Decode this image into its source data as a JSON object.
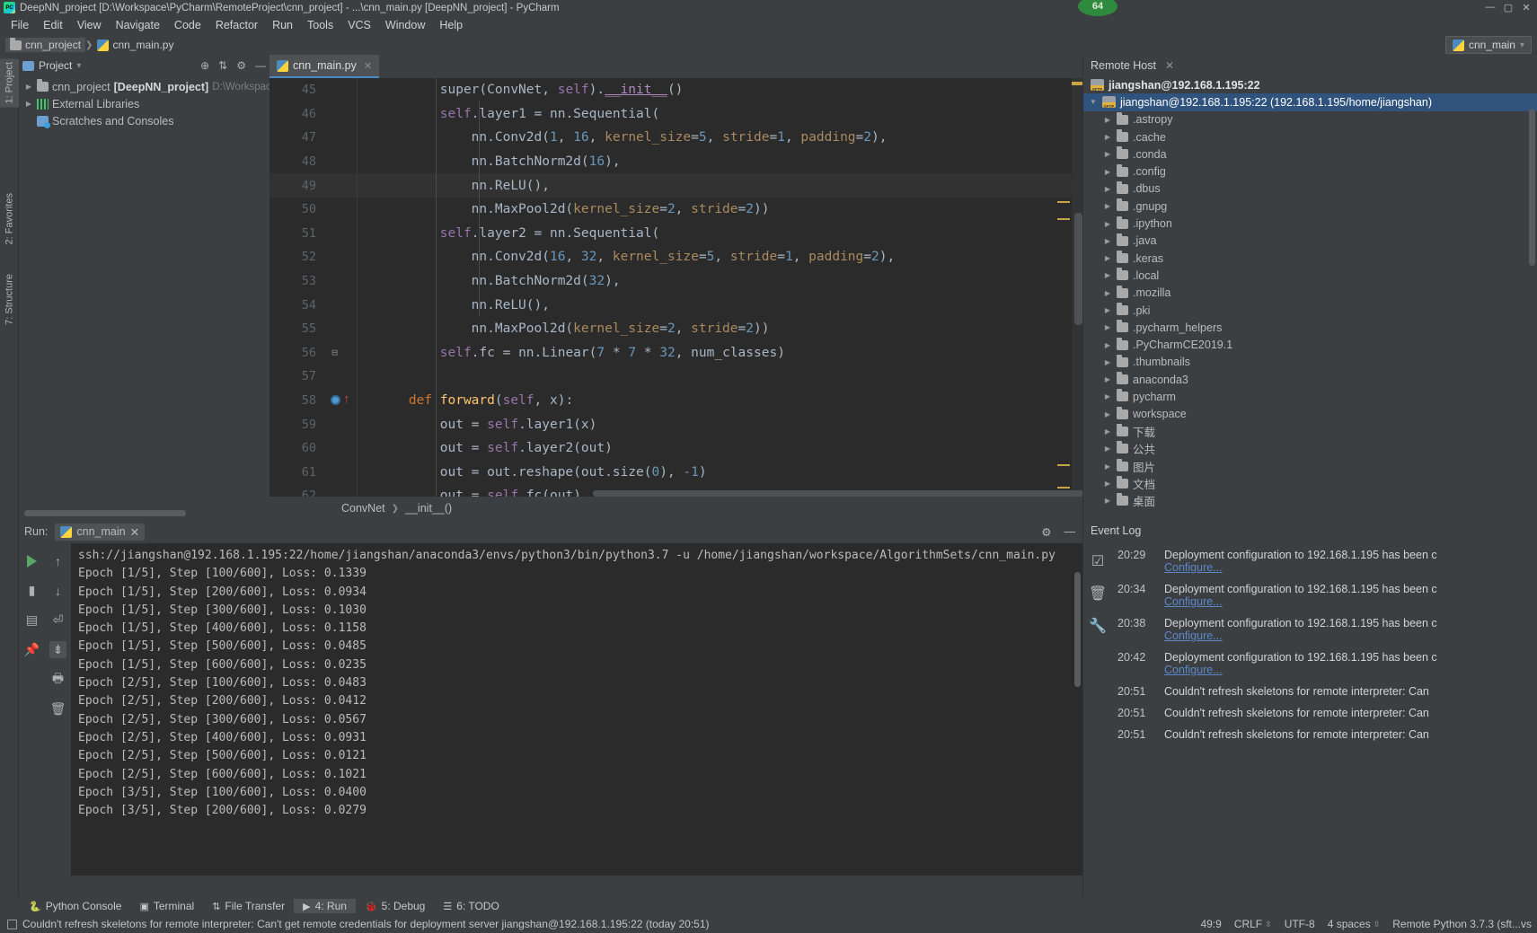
{
  "window": {
    "title": "DeepNN_project [D:\\Workspace\\PyCharm\\RemoteProject\\cnn_project] - ...\\cnn_main.py [DeepNN_project] - PyCharm",
    "badge": "64",
    "minimize": "—",
    "maximize": "▢",
    "close": "✕"
  },
  "menu": [
    "File",
    "Edit",
    "View",
    "Navigate",
    "Code",
    "Refactor",
    "Run",
    "Tools",
    "VCS",
    "Window",
    "Help"
  ],
  "navbar": {
    "crumbs": [
      "cnn_project",
      "cnn_main.py"
    ],
    "run_config": "cnn_main"
  },
  "project_panel": {
    "title": "Project",
    "vertical_tab": "1: Project",
    "tree": [
      {
        "label": "cnn_project",
        "bracket": "[DeepNN_project]",
        "path": "D:\\Workspace",
        "icon": "folder-icon"
      },
      {
        "label": "External Libraries",
        "icon": "library-icon"
      },
      {
        "label": "Scratches and Consoles",
        "icon": "scratches-icon"
      }
    ]
  },
  "left_tabs": [
    "1: Project",
    "2: Favorites",
    "7: Structure"
  ],
  "editor": {
    "tab": "cnn_main.py",
    "breadcrumb": [
      "ConvNet",
      "__init__()"
    ],
    "first_line": 45,
    "highlight_line": 49,
    "breakpoint_line": 58,
    "lines": [
      {
        "n": 45,
        "tokens": [
          {
            "t": "            super",
            "c": "kw"
          },
          {
            "t": "(ConvNet, ",
            "c": "kw"
          },
          {
            "t": "self",
            "c": "s"
          },
          {
            "t": ").",
            "c": "kw"
          },
          {
            "t": "__init__",
            "c": "mg"
          },
          {
            "t": "()",
            "c": "kw"
          }
        ]
      },
      {
        "n": 46,
        "tokens": [
          {
            "t": "            ",
            "c": "kw"
          },
          {
            "t": "self",
            "c": "s"
          },
          {
            "t": ".layer1 = nn.Sequential(",
            "c": "kw"
          }
        ]
      },
      {
        "n": 47,
        "tokens": [
          {
            "t": "                nn.Conv2d(",
            "c": "kw"
          },
          {
            "t": "1",
            "c": "n"
          },
          {
            "t": ", ",
            "c": "kw"
          },
          {
            "t": "16",
            "c": "n"
          },
          {
            "t": ", ",
            "c": "kw"
          },
          {
            "t": "kernel_size",
            "c": "kwarg"
          },
          {
            "t": "=",
            "c": "kw"
          },
          {
            "t": "5",
            "c": "n"
          },
          {
            "t": ", ",
            "c": "kw"
          },
          {
            "t": "stride",
            "c": "kwarg"
          },
          {
            "t": "=",
            "c": "kw"
          },
          {
            "t": "1",
            "c": "n"
          },
          {
            "t": ", ",
            "c": "kw"
          },
          {
            "t": "padding",
            "c": "kwarg"
          },
          {
            "t": "=",
            "c": "kw"
          },
          {
            "t": "2",
            "c": "n"
          },
          {
            "t": "),",
            "c": "kw"
          }
        ]
      },
      {
        "n": 48,
        "tokens": [
          {
            "t": "                nn.BatchNorm2d(",
            "c": "kw"
          },
          {
            "t": "16",
            "c": "n"
          },
          {
            "t": "),",
            "c": "kw"
          }
        ]
      },
      {
        "n": 49,
        "tokens": [
          {
            "t": "                nn.ReLU(),",
            "c": "kw"
          }
        ]
      },
      {
        "n": 50,
        "tokens": [
          {
            "t": "                nn.MaxPool2d(",
            "c": "kw"
          },
          {
            "t": "kernel_size",
            "c": "kwarg"
          },
          {
            "t": "=",
            "c": "kw"
          },
          {
            "t": "2",
            "c": "n"
          },
          {
            "t": ", ",
            "c": "kw"
          },
          {
            "t": "stride",
            "c": "kwarg"
          },
          {
            "t": "=",
            "c": "kw"
          },
          {
            "t": "2",
            "c": "n"
          },
          {
            "t": "))",
            "c": "kw"
          }
        ]
      },
      {
        "n": 51,
        "tokens": [
          {
            "t": "            ",
            "c": "kw"
          },
          {
            "t": "self",
            "c": "s"
          },
          {
            "t": ".layer2 = nn.Sequential(",
            "c": "kw"
          }
        ]
      },
      {
        "n": 52,
        "tokens": [
          {
            "t": "                nn.Conv2d(",
            "c": "kw"
          },
          {
            "t": "16",
            "c": "n"
          },
          {
            "t": ", ",
            "c": "kw"
          },
          {
            "t": "32",
            "c": "n"
          },
          {
            "t": ", ",
            "c": "kw"
          },
          {
            "t": "kernel_size",
            "c": "kwarg"
          },
          {
            "t": "=",
            "c": "kw"
          },
          {
            "t": "5",
            "c": "n"
          },
          {
            "t": ", ",
            "c": "kw"
          },
          {
            "t": "stride",
            "c": "kwarg"
          },
          {
            "t": "=",
            "c": "kw"
          },
          {
            "t": "1",
            "c": "n"
          },
          {
            "t": ", ",
            "c": "kw"
          },
          {
            "t": "padding",
            "c": "kwarg"
          },
          {
            "t": "=",
            "c": "kw"
          },
          {
            "t": "2",
            "c": "n"
          },
          {
            "t": "),",
            "c": "kw"
          }
        ]
      },
      {
        "n": 53,
        "tokens": [
          {
            "t": "                nn.BatchNorm2d(",
            "c": "kw"
          },
          {
            "t": "32",
            "c": "n"
          },
          {
            "t": "),",
            "c": "kw"
          }
        ]
      },
      {
        "n": 54,
        "tokens": [
          {
            "t": "                nn.ReLU(),",
            "c": "kw"
          }
        ]
      },
      {
        "n": 55,
        "tokens": [
          {
            "t": "                nn.MaxPool2d(",
            "c": "kw"
          },
          {
            "t": "kernel_size",
            "c": "kwarg"
          },
          {
            "t": "=",
            "c": "kw"
          },
          {
            "t": "2",
            "c": "n"
          },
          {
            "t": ", ",
            "c": "kw"
          },
          {
            "t": "stride",
            "c": "kwarg"
          },
          {
            "t": "=",
            "c": "kw"
          },
          {
            "t": "2",
            "c": "n"
          },
          {
            "t": "))",
            "c": "kw"
          }
        ]
      },
      {
        "n": 56,
        "tokens": [
          {
            "t": "            ",
            "c": "kw"
          },
          {
            "t": "self",
            "c": "s"
          },
          {
            "t": ".fc = nn.Linear(",
            "c": "kw"
          },
          {
            "t": "7",
            "c": "n"
          },
          {
            "t": " * ",
            "c": "kw"
          },
          {
            "t": "7",
            "c": "n"
          },
          {
            "t": " * ",
            "c": "kw"
          },
          {
            "t": "32",
            "c": "n"
          },
          {
            "t": ", num_classes)",
            "c": "kw"
          }
        ]
      },
      {
        "n": 57,
        "tokens": [
          {
            "t": "",
            "c": "kw"
          }
        ]
      },
      {
        "n": 58,
        "tokens": [
          {
            "t": "        ",
            "c": "kw"
          },
          {
            "t": "def ",
            "c": "k"
          },
          {
            "t": "forward",
            "c": "f"
          },
          {
            "t": "(",
            "c": "kw"
          },
          {
            "t": "self",
            "c": "s"
          },
          {
            "t": ", x):",
            "c": "kw"
          }
        ]
      },
      {
        "n": 59,
        "tokens": [
          {
            "t": "            out = ",
            "c": "kw"
          },
          {
            "t": "self",
            "c": "s"
          },
          {
            "t": ".layer1(x)",
            "c": "kw"
          }
        ]
      },
      {
        "n": 60,
        "tokens": [
          {
            "t": "            out = ",
            "c": "kw"
          },
          {
            "t": "self",
            "c": "s"
          },
          {
            "t": ".layer2(out)",
            "c": "kw"
          }
        ]
      },
      {
        "n": 61,
        "tokens": [
          {
            "t": "            out = out.reshape(out.size(",
            "c": "kw"
          },
          {
            "t": "0",
            "c": "n"
          },
          {
            "t": "), ",
            "c": "kw"
          },
          {
            "t": "-1",
            "c": "n"
          },
          {
            "t": ")",
            "c": "kw"
          }
        ]
      },
      {
        "n": 62,
        "tokens": [
          {
            "t": "            out = ",
            "c": "kw"
          },
          {
            "t": "self",
            "c": "s"
          },
          {
            "t": ".fc(out)",
            "c": "kw"
          }
        ]
      }
    ]
  },
  "remote_panel": {
    "title": "Remote Host",
    "close": "✕",
    "server": "jiangshan@192.168.1.195:22",
    "root": "jiangshan@192.168.1.195:22 (192.168.1.195/home/jiangshan)",
    "items": [
      ".astropy",
      ".cache",
      ".conda",
      ".config",
      ".dbus",
      ".gnupg",
      ".ipython",
      ".java",
      ".keras",
      ".local",
      ".mozilla",
      ".pki",
      ".pycharm_helpers",
      ".PyCharmCE2019.1",
      ".thumbnails",
      "anaconda3",
      "pycharm",
      "workspace",
      "下载",
      "公共",
      "图片",
      "文档",
      "桌面"
    ]
  },
  "run_panel": {
    "label": "Run:",
    "tab": "cnn_main",
    "close": "✕",
    "console": [
      "ssh://jiangshan@192.168.1.195:22/home/jiangshan/anaconda3/envs/python3/bin/python3.7 -u /home/jiangshan/workspace/AlgorithmSets/cnn_main.py",
      "Epoch [1/5], Step [100/600], Loss: 0.1339",
      "Epoch [1/5], Step [200/600], Loss: 0.0934",
      "Epoch [1/5], Step [300/600], Loss: 0.1030",
      "Epoch [1/5], Step [400/600], Loss: 0.1158",
      "Epoch [1/5], Step [500/600], Loss: 0.0485",
      "Epoch [1/5], Step [600/600], Loss: 0.0235",
      "Epoch [2/5], Step [100/600], Loss: 0.0483",
      "Epoch [2/5], Step [200/600], Loss: 0.0412",
      "Epoch [2/5], Step [300/600], Loss: 0.0567",
      "Epoch [2/5], Step [400/600], Loss: 0.0931",
      "Epoch [2/5], Step [500/600], Loss: 0.0121",
      "Epoch [2/5], Step [600/600], Loss: 0.1021",
      "Epoch [3/5], Step [100/600], Loss: 0.0400",
      "Epoch [3/5], Step [200/600], Loss: 0.0279"
    ]
  },
  "event_log": {
    "title": "Event Log",
    "entries": [
      {
        "time": "20:29",
        "message": "Deployment configuration to 192.168.1.195 has been c",
        "link": "Configure..."
      },
      {
        "time": "20:34",
        "message": "Deployment configuration to 192.168.1.195 has been c",
        "link": "Configure..."
      },
      {
        "time": "20:38",
        "message": "Deployment configuration to 192.168.1.195 has been c",
        "link": "Configure..."
      },
      {
        "time": "20:42",
        "message": "Deployment configuration to 192.168.1.195 has been c",
        "link": "Configure..."
      },
      {
        "time": "20:51",
        "message": "Couldn't refresh skeletons for remote interpreter: Can",
        "link": ""
      },
      {
        "time": "20:51",
        "message": "Couldn't refresh skeletons for remote interpreter: Can",
        "link": ""
      },
      {
        "time": "20:51",
        "message": "Couldn't refresh skeletons for remote interpreter: Can",
        "link": ""
      }
    ]
  },
  "toolstrip": [
    {
      "label": "Python Console",
      "icon": "python-icon",
      "active": false
    },
    {
      "label": "Terminal",
      "icon": "terminal-icon",
      "active": false
    },
    {
      "label": "File Transfer",
      "icon": "transfer-icon",
      "active": false
    },
    {
      "label": "4: Run",
      "icon": "run-icon",
      "active": true
    },
    {
      "label": "5: Debug",
      "icon": "debug-icon",
      "active": false
    },
    {
      "label": "6: TODO",
      "icon": "todo-icon",
      "active": false
    }
  ],
  "statusbar": {
    "message": "Couldn't refresh skeletons for remote interpreter: Can't get remote credentials for deployment server jiangshan@192.168.1.195:22 (today 20:51)",
    "caret": "49:9",
    "line_sep": "CRLF",
    "encoding": "UTF-8",
    "indent": "4 spaces",
    "interpreter": "Remote Python 3.7.3 (sft...vs"
  }
}
